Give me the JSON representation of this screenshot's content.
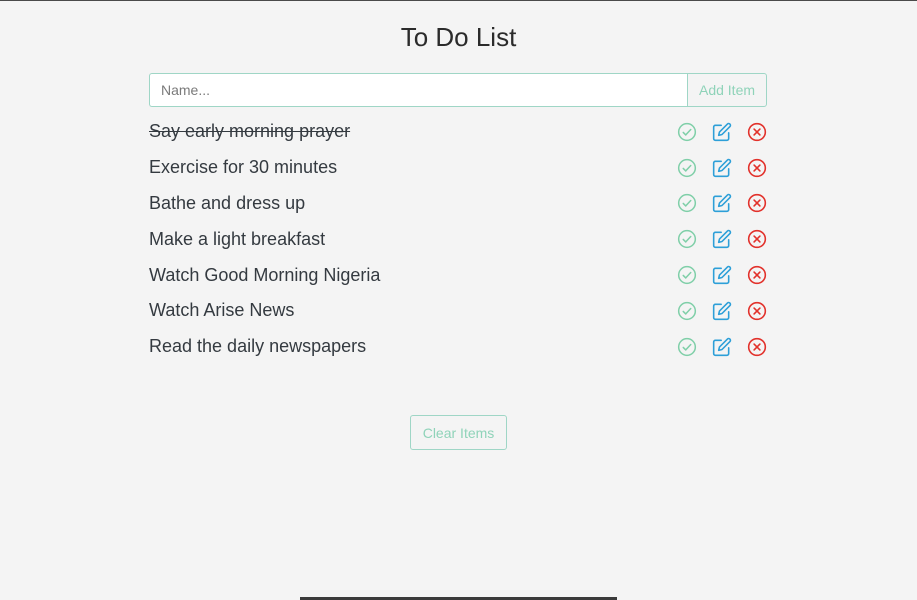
{
  "header": {
    "title": "To Do List"
  },
  "form": {
    "name_placeholder": "Name...",
    "name_value": "",
    "add_label": "Add Item"
  },
  "todos": [
    {
      "text": "Say early morning prayer",
      "done": true
    },
    {
      "text": "Exercise for 30 minutes",
      "done": false
    },
    {
      "text": "Bathe and dress up",
      "done": false
    },
    {
      "text": "Make a light breakfast",
      "done": false
    },
    {
      "text": "Watch Good Morning Nigeria",
      "done": false
    },
    {
      "text": "Watch Arise News",
      "done": false
    },
    {
      "text": "Read the daily newspapers",
      "done": false
    }
  ],
  "row_actions": {
    "complete_icon": "check-circle-icon",
    "edit_icon": "edit-icon",
    "delete_icon": "x-circle-icon"
  },
  "footer": {
    "clear_label": "Clear Items"
  },
  "colors": {
    "accent_green": "#8fd3b9",
    "complete_green": "#7fcfa8",
    "edit_blue": "#2d9fd8",
    "delete_red": "#e2312b",
    "background": "#f4f4f4"
  }
}
